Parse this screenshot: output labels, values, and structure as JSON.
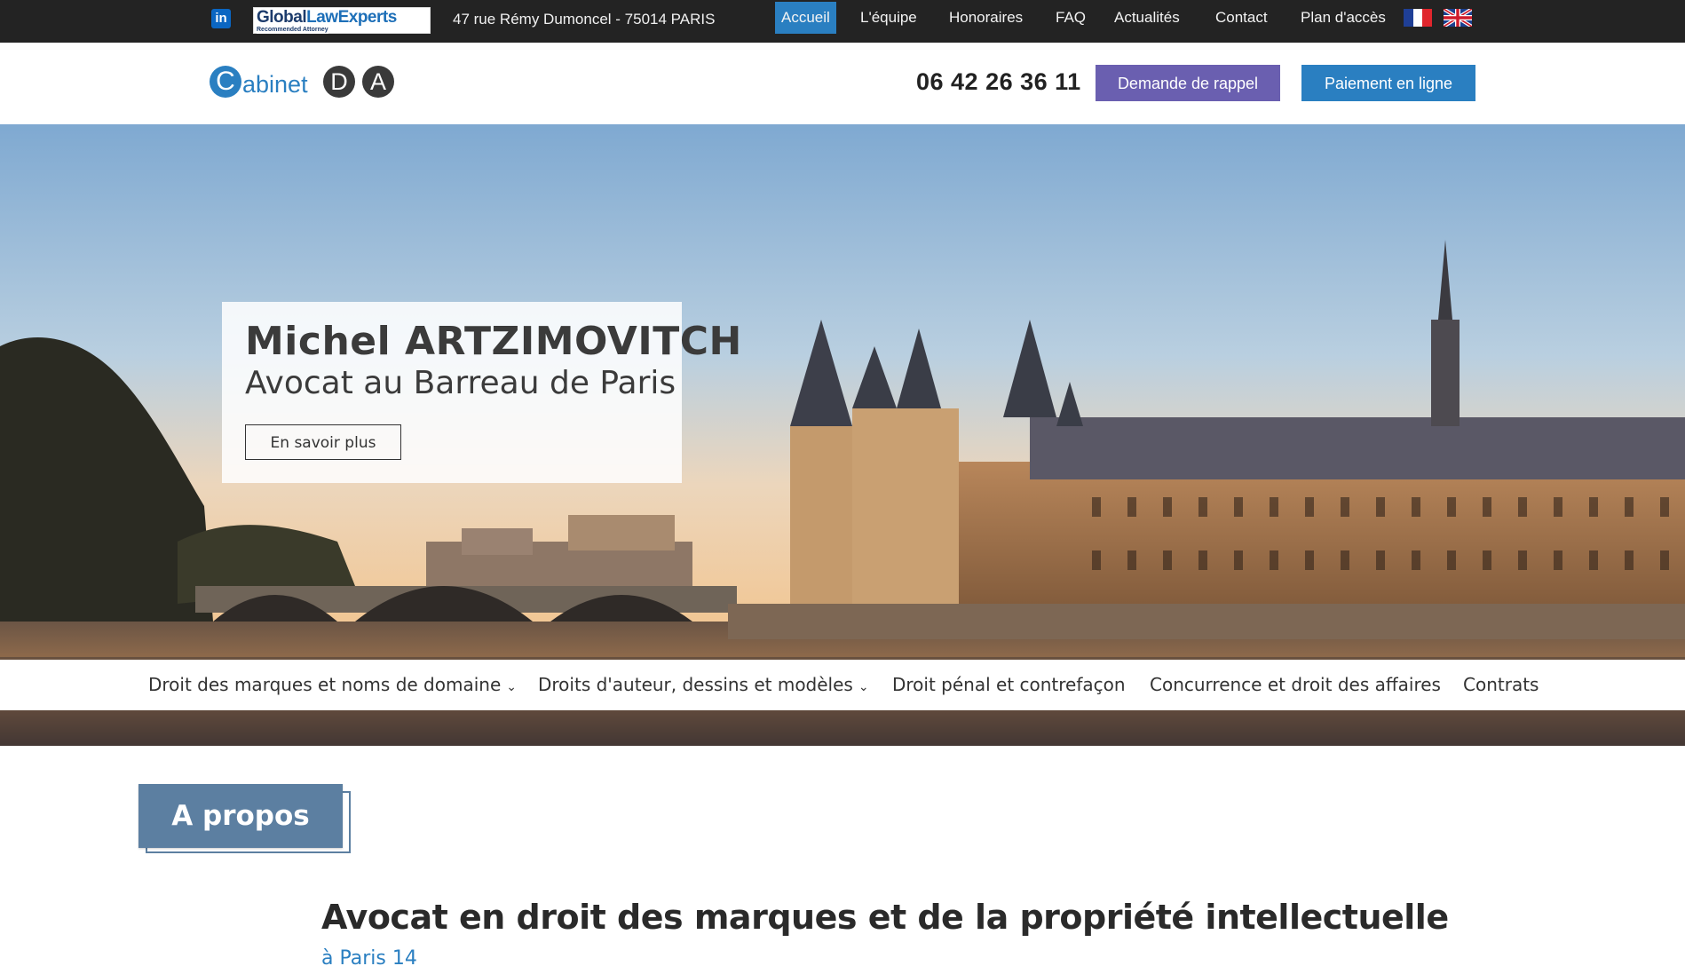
{
  "topbar": {
    "linkedin_icon": "linkedin-icon",
    "gle_brand_a": "Global",
    "gle_brand_b": "LawExperts",
    "gle_tagline": "Recommended Attorney",
    "address": "47 rue Rémy Dumoncel - 75014 PARIS",
    "nav": [
      "Accueil",
      "L'équipe",
      "Honoraires",
      "FAQ",
      "Actualités",
      "Contact",
      "Plan d'accès"
    ],
    "active_nav": "Accueil",
    "languages": [
      "fr-flag-icon",
      "uk-flag-icon"
    ]
  },
  "header": {
    "logo_c": "C",
    "logo_rest": "abinet",
    "logo_d": "D",
    "logo_a": "A",
    "phone": "06 42 26 36 11",
    "callback_button": "Demande de rappel",
    "payment_button": "Paiement en ligne"
  },
  "hero": {
    "name": "Michel ARTZIMOVITCH",
    "role": "Avocat au Barreau de Paris",
    "cta": "En savoir plus"
  },
  "category_nav": [
    {
      "label": "Droit des marques et noms de domaine",
      "has_dropdown": true
    },
    {
      "label": "Droits d'auteur, dessins et modèles",
      "has_dropdown": true
    },
    {
      "label": "Droit pénal et contrefaçon",
      "has_dropdown": false
    },
    {
      "label": "Concurrence et droit des affaires",
      "has_dropdown": false
    },
    {
      "label": "Contrats",
      "has_dropdown": false
    }
  ],
  "about": {
    "badge": "A propos",
    "heading": "Avocat en droit des marques et de la propriété intellectuelle",
    "subheading": "à Paris 14"
  },
  "colors": {
    "topbar_bg": "#232323",
    "accent_blue": "#2a7fc1",
    "callback_purple": "#6a5fb0",
    "about_badge": "#5c7fa1"
  }
}
